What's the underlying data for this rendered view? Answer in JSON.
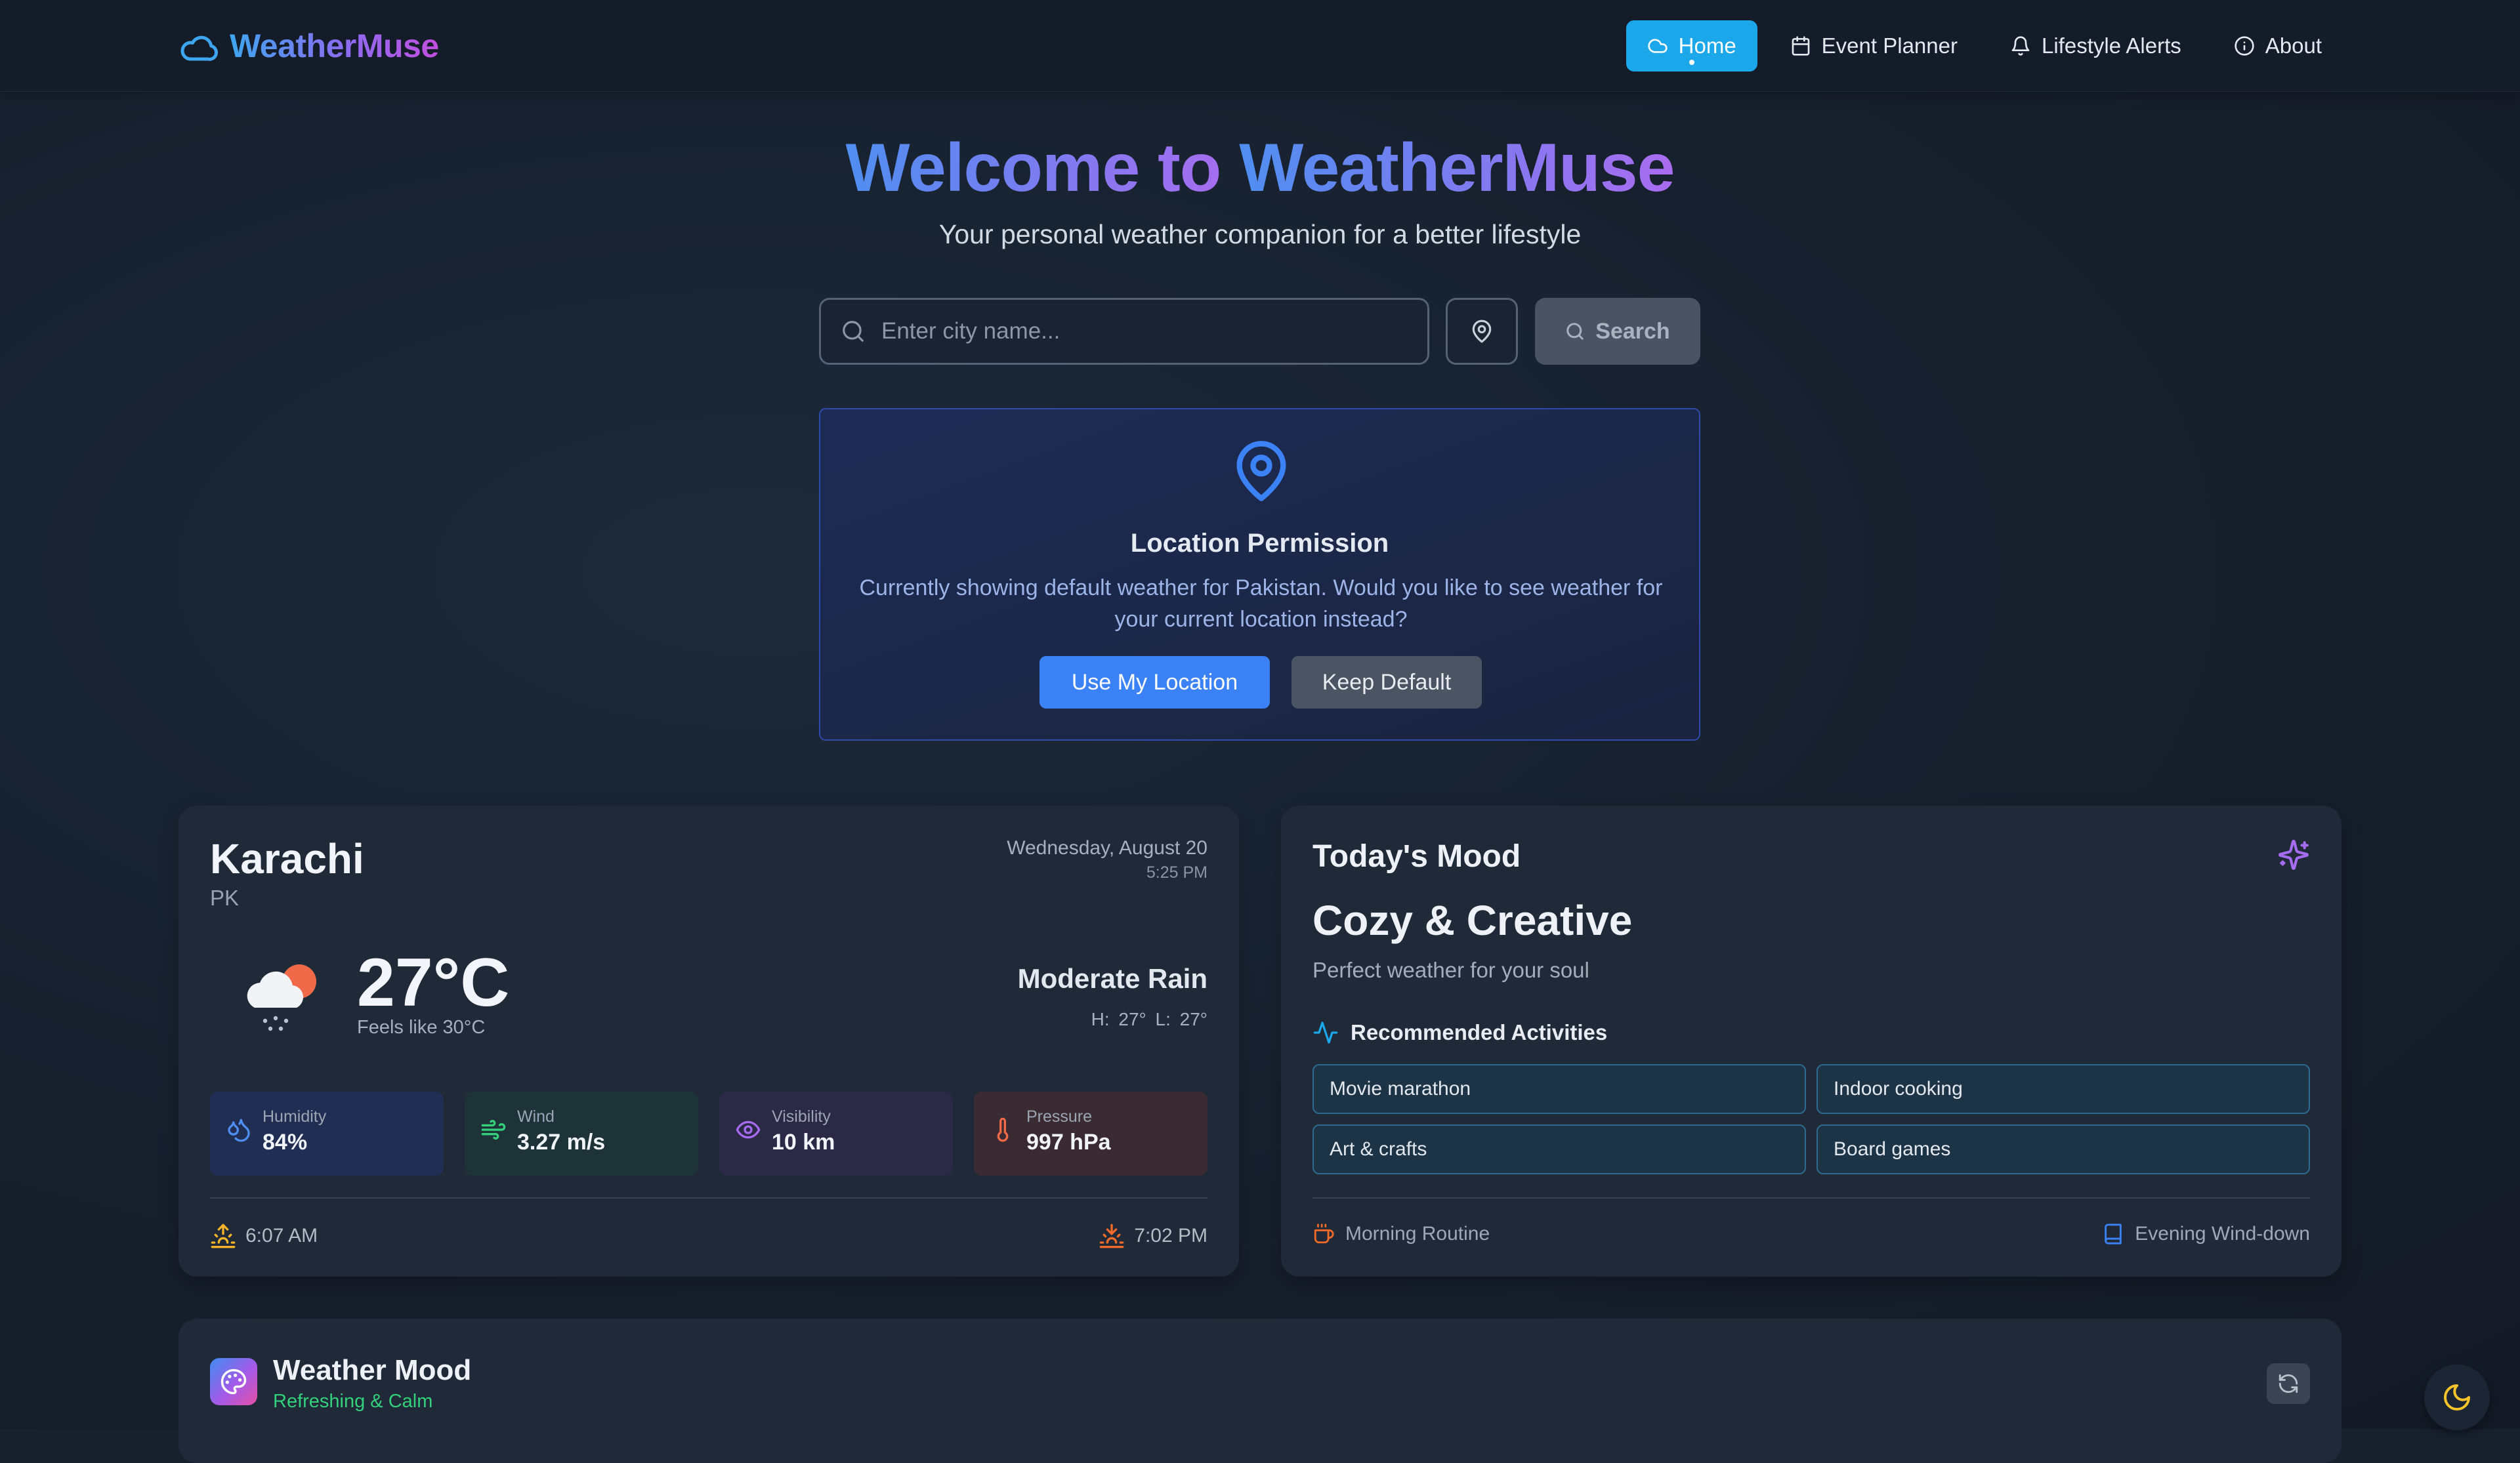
{
  "brand": {
    "name": "WeatherMuse"
  },
  "nav": [
    {
      "label": "Home",
      "icon": "cloud-icon",
      "active": true
    },
    {
      "label": "Event Planner",
      "icon": "calendar-icon"
    },
    {
      "label": "Lifestyle Alerts",
      "icon": "bell-icon"
    },
    {
      "label": "About",
      "icon": "info-icon"
    }
  ],
  "hero": {
    "title_prefix": "Welcome to ",
    "title_brand": "WeatherMuse",
    "subtitle": "Your personal weather companion for a better lifestyle"
  },
  "search": {
    "placeholder": "Enter city name...",
    "value": "",
    "button_label": "Search"
  },
  "permission": {
    "title": "Location Permission",
    "message": "Currently showing default weather for Pakistan. Would you like to see weather for your current location instead?",
    "use_label": "Use My Location",
    "keep_label": "Keep Default"
  },
  "weather": {
    "city": "Karachi",
    "country": "PK",
    "date": "Wednesday, August 20",
    "time": "5:25 PM",
    "temperature": "27°C",
    "feels_like": "Feels like 30°C",
    "condition": "Moderate Rain",
    "high_low": "H: 27°  L: 27°",
    "stats": {
      "humidity": {
        "label": "Humidity",
        "value": "84%"
      },
      "wind": {
        "label": "Wind",
        "value": "3.27 m/s"
      },
      "visibility": {
        "label": "Visibility",
        "value": "10 km"
      },
      "pressure": {
        "label": "Pressure",
        "value": "997 hPa"
      }
    },
    "sunrise": "6:07 AM",
    "sunset": "7:02 PM"
  },
  "mood": {
    "title": "Today's Mood",
    "name": "Cozy & Creative",
    "description": "Perfect weather for your soul",
    "activities_title": "Recommended Activities",
    "activities": [
      "Movie marathon",
      "Indoor cooking",
      "Art & crafts",
      "Board games"
    ],
    "morning": "Morning Routine",
    "evening": "Evening Wind-down"
  },
  "weather_mood": {
    "title": "Weather Mood",
    "subtitle": "Refreshing & Calm"
  },
  "colors": {
    "accent": "#1ba7e9",
    "primary_button": "#3b82f6",
    "mood_subtitle": "#34d17d",
    "background": "#17202d"
  }
}
